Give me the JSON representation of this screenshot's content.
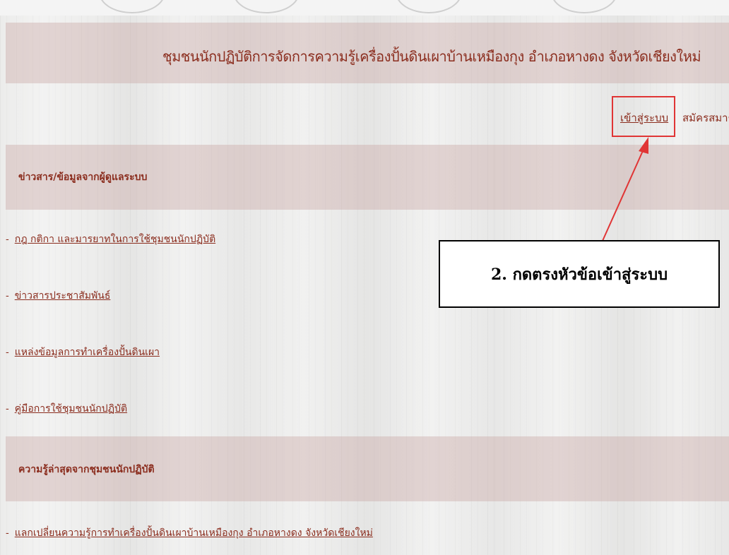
{
  "header": {
    "title": "ชุมชนนักปฏิบัติการจัดการความรู้เครื่องปั้นดินเผาบ้านเหมืองกุง อำเภอหางดง จังหวัดเชียงใหม่"
  },
  "auth": {
    "login_label": "เข้าสู่ระบบ",
    "register_label": "สมัครสมาชิก"
  },
  "news_section": {
    "heading": "ข่าวสาร/ข้อมูลจากผู้ดูแลระบบ",
    "items": [
      {
        "dash": "-",
        "label": "กฎ กติกา และมารยาทในการใช้ชุมชนนักปฏิบัติ"
      },
      {
        "dash": "-",
        "label": "ข่าวสารประชาสัมพันธ์"
      },
      {
        "dash": "-",
        "label": "แหล่งข้อมูลการทำเครื่องปั้นดินเผา"
      },
      {
        "dash": "-",
        "label": "คู่มือการใช้ชุมชนนักปฏิบัติ"
      }
    ]
  },
  "knowledge_section": {
    "heading": "ความรู้ล่าสุดจากชุมชนนักปฏิบัติ",
    "items": [
      {
        "dash": "-",
        "label": "แลกเปลี่ยนความรู้การทำเครื่องปั้นดินเผาบ้านเหมืองกุง อำเภอหางดง จังหวัดเชียงใหม่"
      }
    ]
  },
  "annotation": {
    "text": "2. กดตรงหัวข้อเข้าสู่ระบบ",
    "color": "#e03535"
  }
}
